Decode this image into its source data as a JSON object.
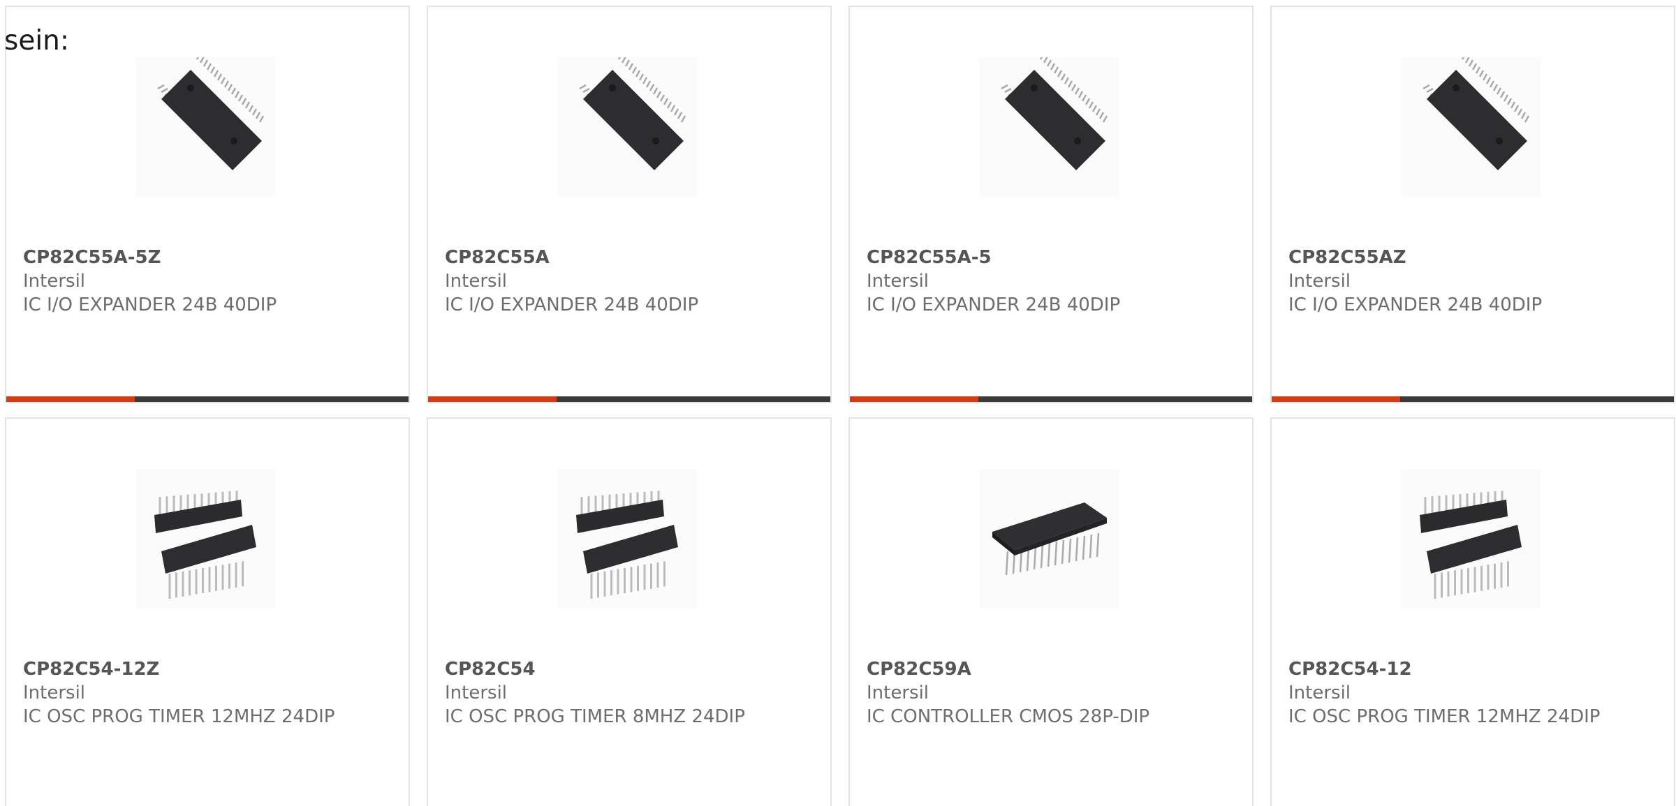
{
  "intro_text": "sein:",
  "products": [
    {
      "part": "CP82C55A-5Z",
      "manufacturer": "Intersil",
      "description": "IC I/O EXPANDER 24B 40DIP",
      "image": "dip40-chip-icon",
      "has_bar": true
    },
    {
      "part": "CP82C55A",
      "manufacturer": "Intersil",
      "description": "IC I/O EXPANDER 24B 40DIP",
      "image": "dip40-chip-icon",
      "has_bar": true
    },
    {
      "part": "CP82C55A-5",
      "manufacturer": "Intersil",
      "description": "IC I/O EXPANDER 24B 40DIP",
      "image": "dip40-chip-icon",
      "has_bar": true
    },
    {
      "part": "CP82C55AZ",
      "manufacturer": "Intersil",
      "description": "IC I/O EXPANDER 24B 40DIP",
      "image": "dip40-chip-icon",
      "has_bar": true
    },
    {
      "part": "CP82C54-12Z",
      "manufacturer": "Intersil",
      "description": "IC OSC PROG TIMER 12MHZ 24DIP",
      "image": "dip24-pair-icon",
      "has_bar": false
    },
    {
      "part": "CP82C54",
      "manufacturer": "Intersil",
      "description": "IC OSC PROG TIMER 8MHZ 24DIP",
      "image": "dip24-pair-icon",
      "has_bar": false
    },
    {
      "part": "CP82C59A",
      "manufacturer": "Intersil",
      "description": "IC CONTROLLER CMOS 28P-DIP",
      "image": "dip28-chip-icon",
      "has_bar": false
    },
    {
      "part": "CP82C54-12",
      "manufacturer": "Intersil",
      "description": "IC OSC PROG TIMER 12MHZ 24DIP",
      "image": "dip24-pair-icon",
      "has_bar": false
    }
  ],
  "bar_progress": 0.32,
  "colors": {
    "accent": "#d63b12",
    "bar_track": "#3a3a3a",
    "border": "#e3e3e3",
    "text": "#6d6d6d"
  }
}
